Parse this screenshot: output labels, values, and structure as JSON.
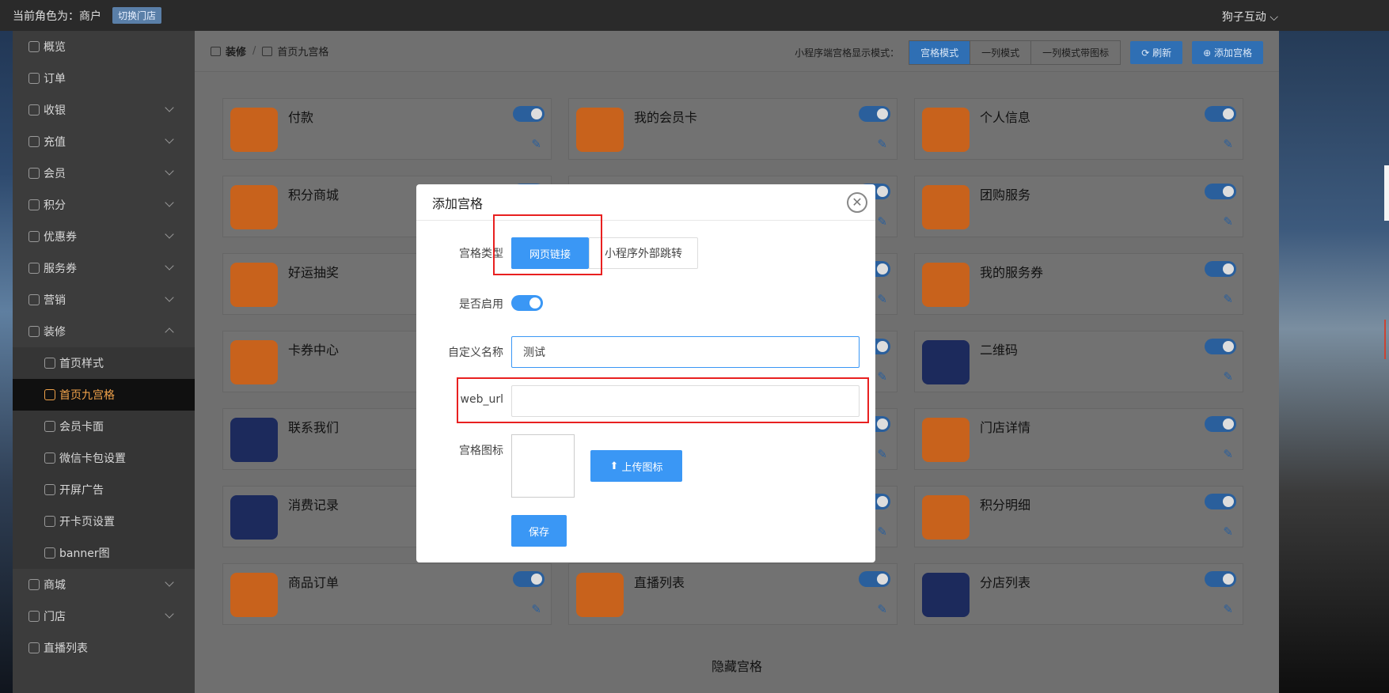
{
  "topbar": {
    "role_text": "当前角色为：商户",
    "switch_label": "切换门店",
    "user_name": "狗子互动"
  },
  "sidebar": {
    "items": [
      {
        "label": "概览",
        "chev": ""
      },
      {
        "label": "订单",
        "chev": ""
      },
      {
        "label": "收银",
        "chev": "down"
      },
      {
        "label": "充值",
        "chev": "down"
      },
      {
        "label": "会员",
        "chev": "down"
      },
      {
        "label": "积分",
        "chev": "down"
      },
      {
        "label": "优惠券",
        "chev": "down"
      },
      {
        "label": "服务券",
        "chev": "down"
      },
      {
        "label": "营销",
        "chev": "down"
      },
      {
        "label": "装修",
        "chev": "up"
      }
    ],
    "sub_items": [
      "首页样式",
      "首页九宫格",
      "会员卡面",
      "微信卡包设置",
      "开屏广告",
      "开卡页设置",
      "banner图"
    ],
    "bottom_items": [
      {
        "label": "商城",
        "chev": "down"
      },
      {
        "label": "门店",
        "chev": "down"
      },
      {
        "label": "直播列表",
        "chev": ""
      }
    ]
  },
  "breadcrumb": {
    "parent": "装修",
    "separator": "/",
    "current": "首页九宫格"
  },
  "modes": {
    "label": "小程序端宫格显示模式：",
    "options": [
      "宫格模式",
      "一列模式",
      "一列模式带图标"
    ],
    "selected": "宫格模式",
    "refresh_label": "刷新",
    "add_label": "添加宫格"
  },
  "grid_items": [
    {
      "name": "付款",
      "color": "#c8621c"
    },
    {
      "name": "我的会员卡",
      "color": "#c8621c"
    },
    {
      "name": "个人信息",
      "color": "#c8621c"
    },
    {
      "name": "积分商城",
      "color": "#c8621c"
    },
    {
      "name": "",
      "color": "#c8621c"
    },
    {
      "name": "团购服务",
      "color": "#c8621c"
    },
    {
      "name": "好运抽奖",
      "color": "#c8621c"
    },
    {
      "name": "",
      "color": "#c8621c"
    },
    {
      "name": "我的服务券",
      "color": "#c8621c"
    },
    {
      "name": "卡券中心",
      "color": "#c8621c"
    },
    {
      "name": "",
      "color": "#c8621c"
    },
    {
      "name": "二维码",
      "color": "#1c2a5c"
    },
    {
      "name": "联系我们",
      "color": "#1c2a5c"
    },
    {
      "name": "",
      "color": "#c8621c"
    },
    {
      "name": "门店详情",
      "color": "#c8621c"
    },
    {
      "name": "消费记录",
      "color": "#1c2a5c"
    },
    {
      "name": "",
      "color": "#c8621c"
    },
    {
      "name": "积分明细",
      "color": "#c8621c"
    },
    {
      "name": "商品订单",
      "color": "#c8621c"
    },
    {
      "name": "直播列表",
      "color": "#c8621c"
    },
    {
      "name": "分店列表",
      "color": "#1c2a5c"
    }
  ],
  "hidden_section_title": "隐藏宫格",
  "modal": {
    "title": "添加宫格",
    "type_label": "宫格类型",
    "type_options": [
      "网页链接",
      "小程序外部跳转"
    ],
    "enable_label": "是否启用",
    "name_label": "自定义名称",
    "name_value": "测试",
    "url_label": "web_url",
    "url_value": "",
    "icon_label": "宫格图标",
    "upload_label": "上传图标",
    "save_label": "保存"
  },
  "colors": {
    "accent": "#3a97f5",
    "highlight": "#e82020",
    "active_nav": "#f0a24a"
  }
}
